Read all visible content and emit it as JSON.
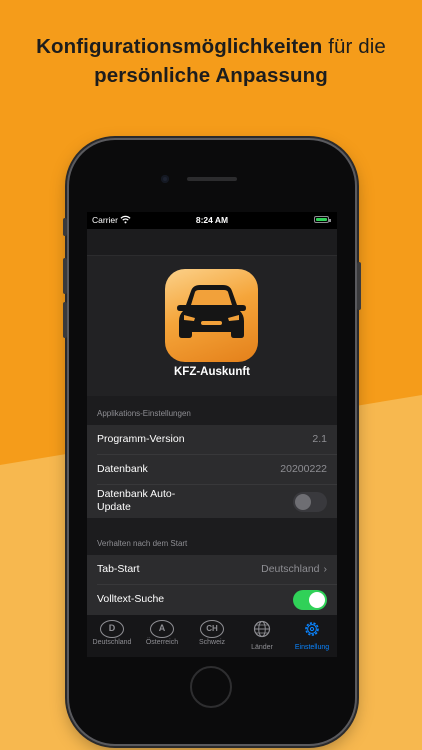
{
  "headline": {
    "part1_bold": "Konfigurationsmöglichkeiten",
    "part2": "für die",
    "line2_bold": "persönliche Anpassung"
  },
  "status_bar": {
    "carrier": "Carrier",
    "time": "8:24 AM"
  },
  "app": {
    "name": "KFZ-Auskunft"
  },
  "sections": {
    "app_settings": {
      "header": "Applikations-Einstellungen",
      "rows": {
        "version": {
          "label": "Programm-Version",
          "value": "2.1"
        },
        "database": {
          "label": "Datenbank",
          "value": "20200222"
        },
        "auto_update": {
          "label": "Datenbank Auto-Update",
          "toggle": false
        }
      }
    },
    "startup": {
      "header": "Verhalten nach dem Start",
      "rows": {
        "tab_start": {
          "label": "Tab-Start",
          "value": "Deutschland"
        },
        "fulltext": {
          "label": "Volltext-Suche",
          "toggle": true
        }
      }
    }
  },
  "tabbar": {
    "tabs": [
      {
        "glyph": "D",
        "label": "Deutschland",
        "icon": "country-badge-icon"
      },
      {
        "glyph": "A",
        "label": "Österreich",
        "icon": "country-badge-icon"
      },
      {
        "glyph": "CH",
        "label": "Schweiz",
        "icon": "country-badge-icon"
      },
      {
        "label": "Länder",
        "icon": "globe-icon"
      },
      {
        "label": "Einstellung",
        "icon": "gear-icon",
        "active": true
      }
    ]
  },
  "colors": {
    "background_orange": "#f59c1a",
    "accent_blue": "#0a84ff",
    "toggle_green": "#30d158"
  }
}
